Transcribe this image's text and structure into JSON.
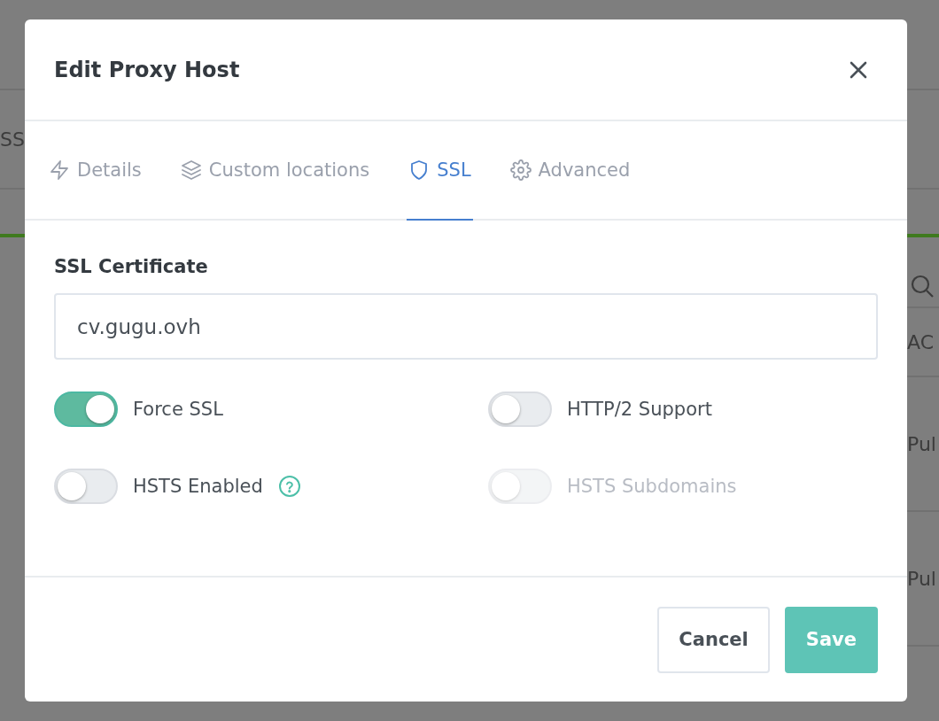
{
  "background": {
    "left_texts": [
      "SS"
    ],
    "right_texts": [
      "AC",
      "Pul",
      "Pul"
    ]
  },
  "dialog": {
    "title": "Edit Proxy Host",
    "tabs": [
      {
        "label": "Details",
        "selected": false
      },
      {
        "label": "Custom locations",
        "selected": false
      },
      {
        "label": "SSL",
        "selected": true
      },
      {
        "label": "Advanced",
        "selected": false
      }
    ],
    "ssl_certificate": {
      "label": "SSL Certificate",
      "value": "cv.gugu.ovh"
    },
    "toggles": [
      {
        "label": "Force SSL",
        "on": true,
        "disabled": false,
        "help": false
      },
      {
        "label": "HTTP/2 Support",
        "on": false,
        "disabled": false,
        "help": false
      },
      {
        "label": "HSTS Enabled",
        "on": false,
        "disabled": false,
        "help": true
      },
      {
        "label": "HSTS Subdomains",
        "on": false,
        "disabled": true,
        "help": false
      }
    ],
    "buttons": [
      {
        "label": "Cancel",
        "kind": "secondary"
      },
      {
        "label": "Save",
        "kind": "primary"
      }
    ]
  }
}
